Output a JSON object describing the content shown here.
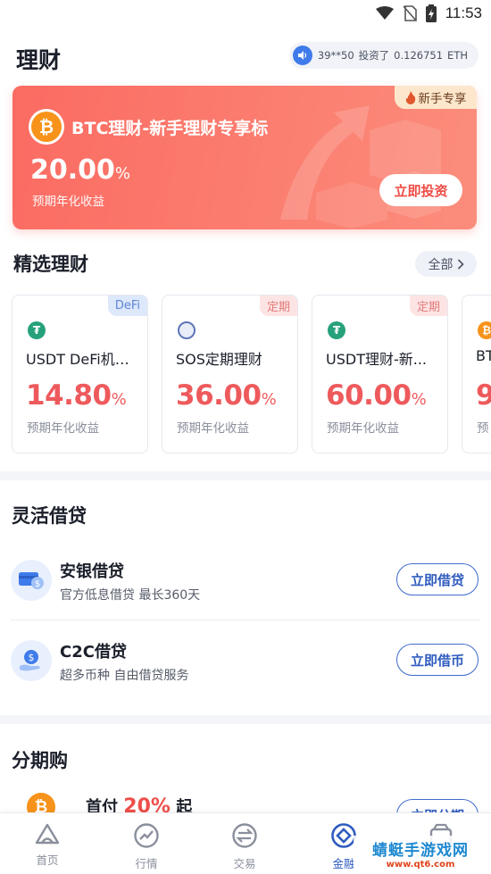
{
  "status": {
    "time": "11:53"
  },
  "header": {
    "title": "理财",
    "ticker": {
      "user": "39**50",
      "action": "投资了",
      "amount": "0.126751",
      "unit": "ETH"
    }
  },
  "banner": {
    "tag": "新手专享",
    "title": "BTC理财-新手理财专享标",
    "rate": "20.00",
    "rate_unit": "%",
    "subtitle": "预期年化收益",
    "button": "立即投资"
  },
  "featured": {
    "title": "精选理财",
    "all_label": "全部",
    "cards": [
      {
        "badge": "DeFi",
        "name": "USDT DeFi机枪...",
        "rate": "14.80",
        "unit": "%",
        "sub": "预期年化收益"
      },
      {
        "badge": "定期",
        "name": "SOS定期理财",
        "rate": "36.00",
        "unit": "%",
        "sub": "预期年化收益"
      },
      {
        "badge": "定期",
        "name": "USDT理财-新...",
        "rate": "60.00",
        "unit": "%",
        "sub": "预期年化收益"
      },
      {
        "badge": "",
        "name": "BT",
        "rate": "9",
        "unit": "",
        "sub": "预"
      }
    ]
  },
  "loans": {
    "title": "灵活借贷",
    "items": [
      {
        "name": "安银借贷",
        "desc": "官方低息借贷 最长360天",
        "button": "立即借贷"
      },
      {
        "name": "C2C借贷",
        "desc": "超多币种 自由借贷服务",
        "button": "立即借币"
      }
    ]
  },
  "installment": {
    "title": "分期购",
    "prefix": "首付",
    "percent": "20%",
    "suffix": "起",
    "button": "立即分期"
  },
  "tabs": [
    {
      "label": "首页",
      "icon": "home-icon"
    },
    {
      "label": "行情",
      "icon": "market-icon"
    },
    {
      "label": "交易",
      "icon": "trade-icon"
    },
    {
      "label": "金融",
      "icon": "finance-icon"
    },
    {
      "label": "资产",
      "icon": "wallet-icon"
    }
  ],
  "watermark": {
    "main": "蜻蜓手游戏网",
    "sub": "www.qt6.com"
  },
  "colors": {
    "accent": "#2f5cbf",
    "banner": "#fb6b62",
    "rate": "#ee5a5c",
    "btc": "#f7931a",
    "usdt": "#26a17b"
  }
}
